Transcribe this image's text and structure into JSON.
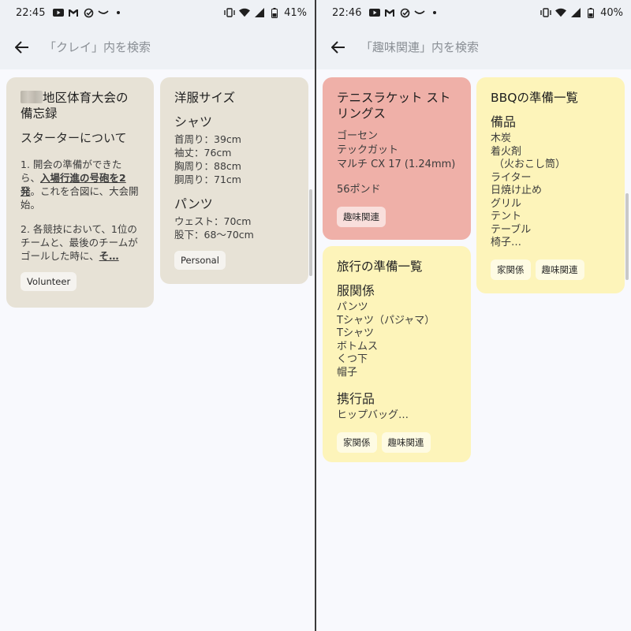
{
  "left": {
    "status": {
      "time": "22:45",
      "battery": "41%"
    },
    "search": {
      "placeholder": "「クレイ」内を検索"
    },
    "card1": {
      "title_suffix": "地区体育大会の備忘録",
      "subtitle": "スターターについて",
      "p1_a": "1. 開会の準備ができたら、",
      "p1_u": "入場行進の号砲を2発",
      "p1_b": "。これを合図に、大会開始。",
      "p2_a": "2. 各競技において、1位のチームと、最後のチームがゴールした時に、",
      "p2_u": "そ…",
      "chip": "Volunteer"
    },
    "card2": {
      "title": "洋服サイズ",
      "h1": "シャツ",
      "l1": "首周り：39cm",
      "l2": "袖丈：76cm",
      "l3": "胸周り：88cm",
      "l4": "胴周り：71cm",
      "h2": "パンツ",
      "l5": "ウェスト：70cm",
      "l6": "股下：68〜70cm",
      "chip": "Personal"
    }
  },
  "right": {
    "status": {
      "time": "22:46",
      "battery": "40%"
    },
    "search": {
      "placeholder": "「趣味関連」内を検索"
    },
    "card1": {
      "title": "テニスラケット ストリングス",
      "l1": "ゴーセン",
      "l2": "テックガット",
      "l3": "マルチ CX 17 (1.24mm)",
      "l4": "56ポンド",
      "chip": "趣味関連"
    },
    "card2": {
      "title": "BBQの準備一覧",
      "h1": "備品",
      "l1": "木炭",
      "l2": "着火剤",
      "l3": "（火おこし筒）",
      "l4": "ライター",
      "l5": "日焼け止め",
      "l6": "グリル",
      "l7": "テント",
      "l8": "テーブル",
      "l9": "椅子…",
      "chip1": "家関係",
      "chip2": "趣味関連"
    },
    "card3": {
      "title": "旅行の準備一覧",
      "h1": "服関係",
      "l1": "パンツ",
      "l2": "Tシャツ（パジャマ）",
      "l3": "Tシャツ",
      "l4": "ボトムス",
      "l5": "くつ下",
      "l6": "帽子",
      "h2": "携行品",
      "l7": "ヒップバッグ…",
      "chip1": "家関係",
      "chip2": "趣味関連"
    }
  },
  "colors": {
    "beige": "#e7e2d6",
    "pink": "#efb0a8",
    "yellow": "#fdf4ba",
    "bar": "#eef1f5"
  },
  "icons": [
    "youtube-icon",
    "gmail-icon",
    "check-circle-icon",
    "smile-icon",
    "dot-icon",
    "vibrate-icon",
    "wifi-icon",
    "signal-icon",
    "battery-icon",
    "back-arrow-icon"
  ]
}
